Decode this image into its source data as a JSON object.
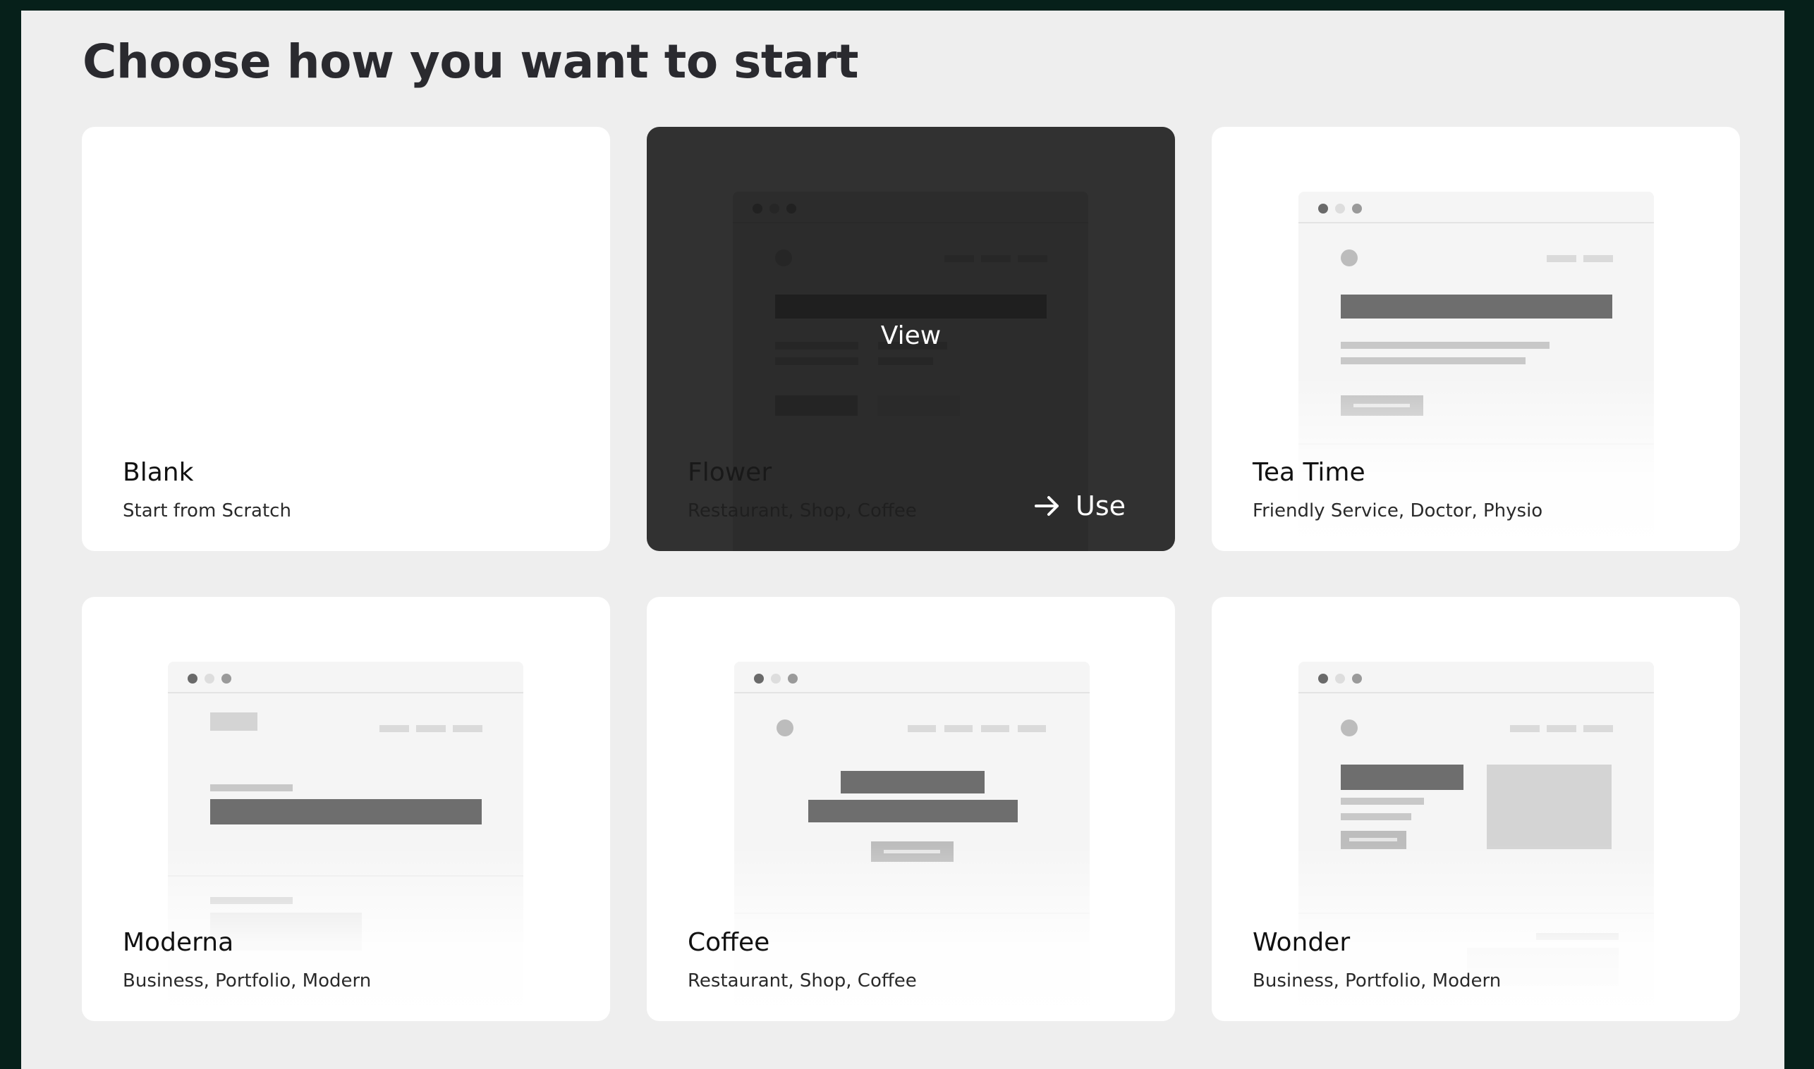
{
  "page": {
    "title": "Choose how you want to start"
  },
  "templates": [
    {
      "name": "Blank",
      "tags": "Start from Scratch"
    },
    {
      "name": "Flower",
      "tags": "Restaurant, Shop, Coffee",
      "hover_view_label": "View",
      "hover_use_label": "Use"
    },
    {
      "name": "Tea Time",
      "tags": "Friendly Service, Doctor, Physio"
    },
    {
      "name": "Moderna",
      "tags": "Business, Portfolio, Modern"
    },
    {
      "name": "Coffee",
      "tags": "Restaurant, Shop, Coffee"
    },
    {
      "name": "Wonder",
      "tags": "Business, Portfolio, Modern"
    }
  ],
  "colors": {
    "page_background": "#eeeeee",
    "frame": "#06201a",
    "card": "#ffffff",
    "hover_card": "#343434",
    "wireframe_block": "#6e6e6e"
  },
  "icons": {
    "use_button": "arrow-right-icon"
  }
}
